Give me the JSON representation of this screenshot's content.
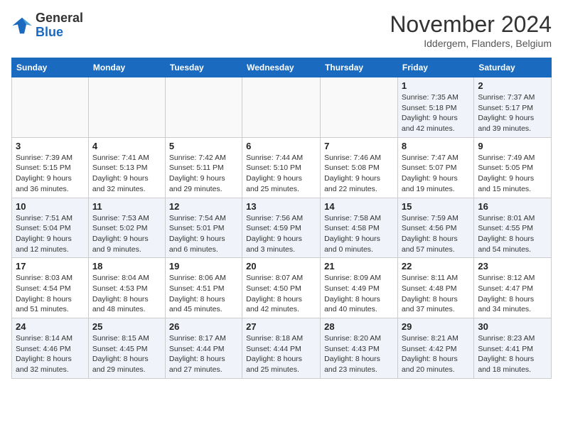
{
  "header": {
    "logo_line1": "General",
    "logo_line2": "Blue",
    "month_title": "November 2024",
    "location": "Iddergem, Flanders, Belgium"
  },
  "weekdays": [
    "Sunday",
    "Monday",
    "Tuesday",
    "Wednesday",
    "Thursday",
    "Friday",
    "Saturday"
  ],
  "weeks": [
    [
      {
        "day": "",
        "info": ""
      },
      {
        "day": "",
        "info": ""
      },
      {
        "day": "",
        "info": ""
      },
      {
        "day": "",
        "info": ""
      },
      {
        "day": "",
        "info": ""
      },
      {
        "day": "1",
        "info": "Sunrise: 7:35 AM\nSunset: 5:18 PM\nDaylight: 9 hours and 42 minutes."
      },
      {
        "day": "2",
        "info": "Sunrise: 7:37 AM\nSunset: 5:17 PM\nDaylight: 9 hours and 39 minutes."
      }
    ],
    [
      {
        "day": "3",
        "info": "Sunrise: 7:39 AM\nSunset: 5:15 PM\nDaylight: 9 hours and 36 minutes."
      },
      {
        "day": "4",
        "info": "Sunrise: 7:41 AM\nSunset: 5:13 PM\nDaylight: 9 hours and 32 minutes."
      },
      {
        "day": "5",
        "info": "Sunrise: 7:42 AM\nSunset: 5:11 PM\nDaylight: 9 hours and 29 minutes."
      },
      {
        "day": "6",
        "info": "Sunrise: 7:44 AM\nSunset: 5:10 PM\nDaylight: 9 hours and 25 minutes."
      },
      {
        "day": "7",
        "info": "Sunrise: 7:46 AM\nSunset: 5:08 PM\nDaylight: 9 hours and 22 minutes."
      },
      {
        "day": "8",
        "info": "Sunrise: 7:47 AM\nSunset: 5:07 PM\nDaylight: 9 hours and 19 minutes."
      },
      {
        "day": "9",
        "info": "Sunrise: 7:49 AM\nSunset: 5:05 PM\nDaylight: 9 hours and 15 minutes."
      }
    ],
    [
      {
        "day": "10",
        "info": "Sunrise: 7:51 AM\nSunset: 5:04 PM\nDaylight: 9 hours and 12 minutes."
      },
      {
        "day": "11",
        "info": "Sunrise: 7:53 AM\nSunset: 5:02 PM\nDaylight: 9 hours and 9 minutes."
      },
      {
        "day": "12",
        "info": "Sunrise: 7:54 AM\nSunset: 5:01 PM\nDaylight: 9 hours and 6 minutes."
      },
      {
        "day": "13",
        "info": "Sunrise: 7:56 AM\nSunset: 4:59 PM\nDaylight: 9 hours and 3 minutes."
      },
      {
        "day": "14",
        "info": "Sunrise: 7:58 AM\nSunset: 4:58 PM\nDaylight: 9 hours and 0 minutes."
      },
      {
        "day": "15",
        "info": "Sunrise: 7:59 AM\nSunset: 4:56 PM\nDaylight: 8 hours and 57 minutes."
      },
      {
        "day": "16",
        "info": "Sunrise: 8:01 AM\nSunset: 4:55 PM\nDaylight: 8 hours and 54 minutes."
      }
    ],
    [
      {
        "day": "17",
        "info": "Sunrise: 8:03 AM\nSunset: 4:54 PM\nDaylight: 8 hours and 51 minutes."
      },
      {
        "day": "18",
        "info": "Sunrise: 8:04 AM\nSunset: 4:53 PM\nDaylight: 8 hours and 48 minutes."
      },
      {
        "day": "19",
        "info": "Sunrise: 8:06 AM\nSunset: 4:51 PM\nDaylight: 8 hours and 45 minutes."
      },
      {
        "day": "20",
        "info": "Sunrise: 8:07 AM\nSunset: 4:50 PM\nDaylight: 8 hours and 42 minutes."
      },
      {
        "day": "21",
        "info": "Sunrise: 8:09 AM\nSunset: 4:49 PM\nDaylight: 8 hours and 40 minutes."
      },
      {
        "day": "22",
        "info": "Sunrise: 8:11 AM\nSunset: 4:48 PM\nDaylight: 8 hours and 37 minutes."
      },
      {
        "day": "23",
        "info": "Sunrise: 8:12 AM\nSunset: 4:47 PM\nDaylight: 8 hours and 34 minutes."
      }
    ],
    [
      {
        "day": "24",
        "info": "Sunrise: 8:14 AM\nSunset: 4:46 PM\nDaylight: 8 hours and 32 minutes."
      },
      {
        "day": "25",
        "info": "Sunrise: 8:15 AM\nSunset: 4:45 PM\nDaylight: 8 hours and 29 minutes."
      },
      {
        "day": "26",
        "info": "Sunrise: 8:17 AM\nSunset: 4:44 PM\nDaylight: 8 hours and 27 minutes."
      },
      {
        "day": "27",
        "info": "Sunrise: 8:18 AM\nSunset: 4:44 PM\nDaylight: 8 hours and 25 minutes."
      },
      {
        "day": "28",
        "info": "Sunrise: 8:20 AM\nSunset: 4:43 PM\nDaylight: 8 hours and 23 minutes."
      },
      {
        "day": "29",
        "info": "Sunrise: 8:21 AM\nSunset: 4:42 PM\nDaylight: 8 hours and 20 minutes."
      },
      {
        "day": "30",
        "info": "Sunrise: 8:23 AM\nSunset: 4:41 PM\nDaylight: 8 hours and 18 minutes."
      }
    ]
  ]
}
